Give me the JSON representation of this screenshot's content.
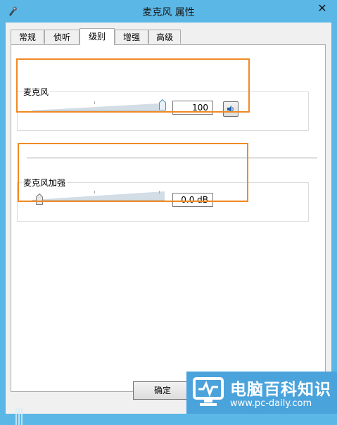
{
  "window": {
    "title": "麦克风 属性",
    "close_icon": "close-icon",
    "app_icon": "microphone-icon"
  },
  "tabs": [
    {
      "label": "常规",
      "active": false
    },
    {
      "label": "侦听",
      "active": false
    },
    {
      "label": "级别",
      "active": true
    },
    {
      "label": "增强",
      "active": false
    },
    {
      "label": "高级",
      "active": false
    }
  ],
  "levels": {
    "microphone": {
      "label": "麦克风",
      "value": "100",
      "level_fraction": 1.0,
      "mute_icon": "speaker-icon"
    },
    "boost": {
      "label": "麦克风加强",
      "value": "0.0 dB",
      "level_fraction": 0.0
    }
  },
  "buttons": {
    "ok": "确定"
  },
  "watermark": {
    "title": "电脑百科知识",
    "url": "www.pc-daily.com"
  },
  "colors": {
    "titlebar": "#5bb8e6",
    "highlight": "#f08a24",
    "watermark_bg": "#4ba3dc"
  }
}
